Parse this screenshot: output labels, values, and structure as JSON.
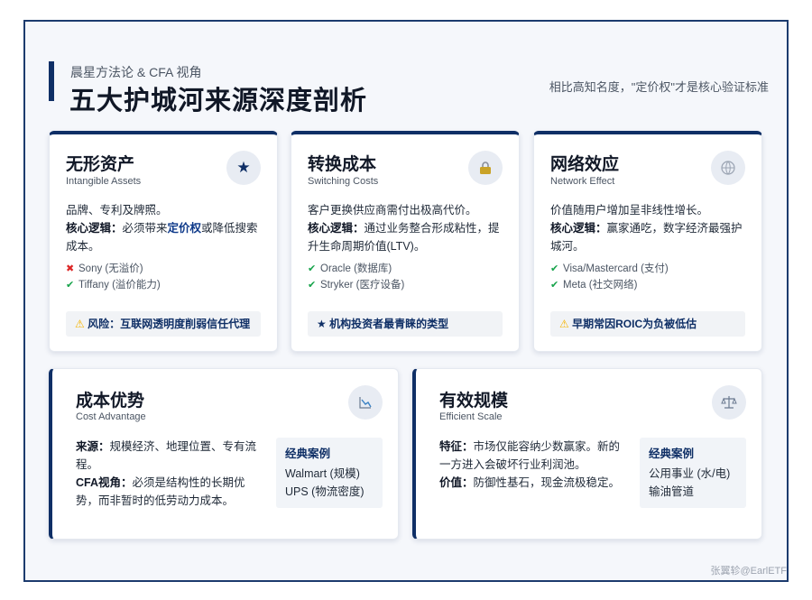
{
  "header": {
    "subtitle": "晨星方法论 & CFA 视角",
    "title": "五大护城河来源深度剖析",
    "tagline": "相比高知名度，\"定价权\"才是核心验证标准"
  },
  "cards": [
    {
      "title": "无形资产",
      "title_en": "Intangible Assets",
      "icon": "star-icon",
      "line1": "品牌、专利及牌照。",
      "logic_label": "核心逻辑：",
      "logic_pre": "必须带来",
      "logic_hl": "定价权",
      "logic_post": "或降低搜索成本。",
      "examples": [
        {
          "mark": "cross",
          "text": "Sony (无溢价)"
        },
        {
          "mark": "check",
          "text": "Tiffany (溢价能力)"
        }
      ],
      "note_icon": "warning-icon",
      "note": "风险：互联网透明度削弱信任代理"
    },
    {
      "title": "转换成本",
      "title_en": "Switching Costs",
      "icon": "lock-icon",
      "line1": "客户更换供应商需付出极高代价。",
      "logic_label": "核心逻辑：",
      "logic_pre": "通过业务整合形成粘性，提升生命周期价值(LTV)。",
      "logic_hl": "",
      "logic_post": "",
      "examples": [
        {
          "mark": "check",
          "text": "Oracle (数据库)"
        },
        {
          "mark": "check",
          "text": "Stryker (医疗设备)"
        }
      ],
      "note_icon": "star-icon",
      "note": "机构投资者最青睐的类型"
    },
    {
      "title": "网络效应",
      "title_en": "Network Effect",
      "icon": "network-icon",
      "line1": "价值随用户增加呈非线性增长。",
      "logic_label": "核心逻辑：",
      "logic_pre": "赢家通吃，数字经济最强护城河。",
      "logic_hl": "",
      "logic_post": "",
      "examples": [
        {
          "mark": "check",
          "text": "Visa/Mastercard (支付)"
        },
        {
          "mark": "check",
          "text": "Meta (社交网络)"
        }
      ],
      "note_icon": "warning-icon",
      "note": "早期常因ROIC为负被低估"
    }
  ],
  "bottom_cards": [
    {
      "title": "成本优势",
      "title_en": "Cost Advantage",
      "icon": "chart-down-icon",
      "p1_label": "来源：",
      "p1": "规模经济、地理位置、专有流程。",
      "p2_label": "CFA视角：",
      "p2": "必须是结构性的长期优势，而非暂时的低劳动力成本。",
      "cases_title": "经典案例",
      "cases": [
        "Walmart (规模)",
        "UPS (物流密度)"
      ]
    },
    {
      "title": "有效规模",
      "title_en": "Efficient Scale",
      "icon": "scale-icon",
      "p1_label": "特征：",
      "p1": "市场仅能容纳少数赢家。新的一方进入会破坏行业利润池。",
      "p2_label": "价值：",
      "p2": "防御性基石，现金流极稳定。",
      "cases_title": "经典案例",
      "cases": [
        "公用事业 (水/电)",
        "输油管道"
      ]
    }
  ],
  "watermark": "张翼轸@EarlETF",
  "colors": {
    "navy": "#0f2f66",
    "check": "#16a34a",
    "cross": "#dc2626",
    "warning": "#f5b400"
  }
}
